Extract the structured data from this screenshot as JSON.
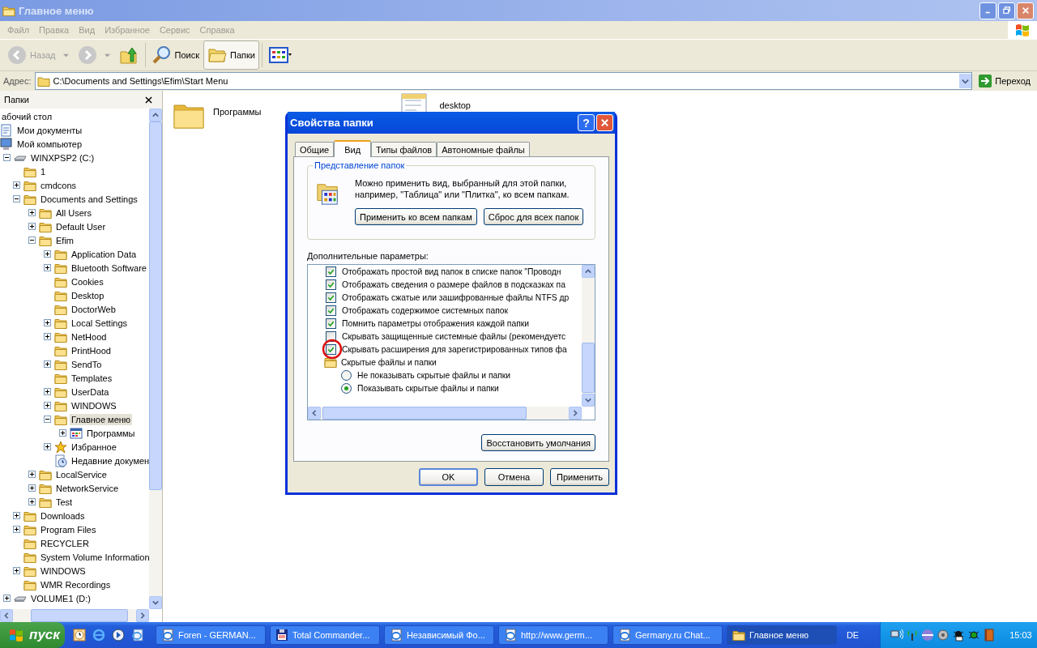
{
  "window": {
    "title": "Главное меню",
    "active": false
  },
  "menu": [
    "Файл",
    "Правка",
    "Вид",
    "Избранное",
    "Сервис",
    "Справка"
  ],
  "toolbar": {
    "back": {
      "label": "Назад",
      "disabled": true
    },
    "forward": {
      "disabled": true
    },
    "search": {
      "label": "Поиск"
    },
    "folders": {
      "label": "Папки",
      "pressed": true
    }
  },
  "address": {
    "label": "Адрес:",
    "value": "C:\\Documents and Settings\\Efim\\Start Menu",
    "go": "Переход"
  },
  "folders_pane": {
    "title": "Папки",
    "tree": [
      {
        "label": "абочий стол",
        "selected": false,
        "children": [
          {
            "label": "Мои документы",
            "kind": "documents",
            "selected": false
          },
          {
            "label": "Мой компьютер",
            "kind": "computer",
            "selected": false,
            "children": [
              {
                "label": "WINXPSP2 (C:)",
                "kind": "drive",
                "expanded": true,
                "selected": false,
                "children": [
                  {
                    "label": "1",
                    "kind": "folder",
                    "selected": false
                  },
                  {
                    "label": "cmdcons",
                    "kind": "folder",
                    "expanded": false,
                    "selected": false
                  },
                  {
                    "label": "Documents and Settings",
                    "kind": "folder",
                    "expanded": true,
                    "selected": false,
                    "children": [
                      {
                        "label": "All Users",
                        "kind": "folder",
                        "expanded": false,
                        "selected": false
                      },
                      {
                        "label": "Default User",
                        "kind": "folder",
                        "expanded": false,
                        "selected": false
                      },
                      {
                        "label": "Efim",
                        "kind": "folder",
                        "expanded": true,
                        "selected": false,
                        "children": [
                          {
                            "label": "Application Data",
                            "kind": "folder",
                            "expanded": false,
                            "selected": false
                          },
                          {
                            "label": "Bluetooth Software",
                            "kind": "folder",
                            "expanded": false,
                            "selected": false
                          },
                          {
                            "label": "Cookies",
                            "kind": "folder",
                            "selected": false
                          },
                          {
                            "label": "Desktop",
                            "kind": "folder",
                            "selected": false
                          },
                          {
                            "label": "DoctorWeb",
                            "kind": "folder",
                            "selected": false
                          },
                          {
                            "label": "Local Settings",
                            "kind": "folder",
                            "expanded": false,
                            "selected": false
                          },
                          {
                            "label": "NetHood",
                            "kind": "folder",
                            "expanded": false,
                            "selected": false
                          },
                          {
                            "label": "PrintHood",
                            "kind": "folder",
                            "selected": false
                          },
                          {
                            "label": "SendTo",
                            "kind": "folder",
                            "expanded": false,
                            "selected": false
                          },
                          {
                            "label": "Templates",
                            "kind": "folder",
                            "selected": false
                          },
                          {
                            "label": "UserData",
                            "kind": "folder",
                            "expanded": false,
                            "selected": false
                          },
                          {
                            "label": "WINDOWS",
                            "kind": "folder",
                            "expanded": false,
                            "selected": false
                          },
                          {
                            "label": "Главное меню",
                            "kind": "folder",
                            "expanded": true,
                            "selected": true,
                            "children": [
                              {
                                "label": "Программы",
                                "kind": "programs",
                                "expanded": false,
                                "selected": false
                              }
                            ]
                          },
                          {
                            "label": "Избранное",
                            "kind": "star",
                            "expanded": false,
                            "selected": false
                          },
                          {
                            "label": "Недавние докумен",
                            "kind": "recent",
                            "selected": false
                          }
                        ]
                      },
                      {
                        "label": "LocalService",
                        "kind": "folder",
                        "expanded": false,
                        "selected": false
                      },
                      {
                        "label": "NetworkService",
                        "kind": "folder",
                        "expanded": false,
                        "selected": false
                      },
                      {
                        "label": "Test",
                        "kind": "folder",
                        "expanded": false,
                        "selected": false
                      }
                    ]
                  },
                  {
                    "label": "Downloads",
                    "kind": "folder",
                    "expanded": false,
                    "selected": false
                  },
                  {
                    "label": "Program Files",
                    "kind": "folder",
                    "expanded": false,
                    "selected": false
                  },
                  {
                    "label": "RECYCLER",
                    "kind": "folder",
                    "selected": false
                  },
                  {
                    "label": "System Volume Information",
                    "kind": "folder",
                    "selected": false
                  },
                  {
                    "label": "WINDOWS",
                    "kind": "folder",
                    "expanded": false,
                    "selected": false
                  },
                  {
                    "label": "WMR Recordings",
                    "kind": "folder",
                    "selected": false
                  }
                ]
              },
              {
                "label": "VOLUME1 (D:)",
                "kind": "drive",
                "expanded": false,
                "selected": false
              }
            ]
          }
        ]
      }
    ]
  },
  "files": [
    {
      "label": "Программы",
      "kind": "folder"
    },
    {
      "label": "desktop",
      "kind": "document"
    }
  ],
  "dialog": {
    "title": "Свойства папки",
    "help": "?",
    "tabs": [
      {
        "label": "Общие",
        "selected": false
      },
      {
        "label": "Вид",
        "selected": true
      },
      {
        "label": "Типы файлов",
        "selected": false
      },
      {
        "label": "Автономные файлы",
        "selected": false
      }
    ],
    "group": {
      "title": "Представление папок",
      "text": "Можно применить вид, выбранный для этой папки, например, \"Таблица\" или \"Плитка\", ко всем папкам.",
      "buttons": [
        "Применить ко всем папкам",
        "Сброс для всех папок"
      ]
    },
    "advanced_label": "Дополнительные параметры:",
    "options": [
      {
        "kind": "checkbox",
        "label": "Отображать простой вид папок в списке папок \"Проводн",
        "checked": true,
        "annotated": false
      },
      {
        "kind": "checkbox",
        "label": "Отображать сведения о размере файлов в подсказках па",
        "checked": true,
        "annotated": false
      },
      {
        "kind": "checkbox",
        "label": "Отображать сжатые или зашифрованные файлы NTFS др",
        "checked": true,
        "annotated": false
      },
      {
        "kind": "checkbox",
        "label": "Отображать содержимое системных папок",
        "checked": true,
        "annotated": false
      },
      {
        "kind": "checkbox",
        "label": "Помнить параметры отображения каждой папки",
        "checked": true,
        "annotated": false
      },
      {
        "kind": "checkbox",
        "label": "Скрывать защищенные системные файлы (рекомендуетс",
        "checked": false,
        "annotated": false
      },
      {
        "kind": "checkbox",
        "label": "Скрывать расширения для зарегистрированных типов фа",
        "checked": true,
        "annotated": true
      },
      {
        "kind": "folder",
        "label": "Скрытые файлы и папки",
        "children": [
          {
            "kind": "radio",
            "label": "Не показывать скрытые файлы и папки",
            "selected": false
          },
          {
            "kind": "radio",
            "label": "Показывать скрытые файлы и папки",
            "selected": true
          }
        ]
      }
    ],
    "restore": "Восстановить умолчания",
    "buttons": [
      {
        "label": "OK",
        "default": true
      },
      {
        "label": "Отмена",
        "default": false
      },
      {
        "label": "Применить",
        "default": false
      }
    ]
  },
  "taskbar": {
    "start": "пуск",
    "tasks": [
      {
        "label": "Foren - GERMAN...",
        "kind": "browser",
        "selected": false
      },
      {
        "label": "Total Commander...",
        "kind": "floppy",
        "selected": false
      },
      {
        "label": "Независимый Фо...",
        "kind": "browser",
        "selected": false
      },
      {
        "label": "http://www.germ...",
        "kind": "browser",
        "selected": false
      },
      {
        "label": "Germany.ru Chat...",
        "kind": "browser",
        "selected": false
      },
      {
        "label": "Главное меню",
        "kind": "folder",
        "selected": true
      }
    ],
    "language": "DE",
    "clock": "15:03"
  }
}
